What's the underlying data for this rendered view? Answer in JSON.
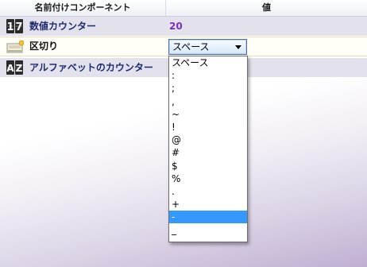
{
  "header": {
    "name_col": "名前付けコンポーネント",
    "value_col": "値"
  },
  "rows": [
    {
      "icon": "numeric-counter-icon",
      "label": "数値カウンター",
      "value": "20"
    },
    {
      "icon": "separator-icon",
      "label": "区切り"
    },
    {
      "icon": "alphabet-counter-icon",
      "label": "アルファベットのカウンター"
    }
  ],
  "separator_select": {
    "selected": "スペース",
    "options": [
      "スペース",
      ":",
      ";",
      ",",
      "~",
      "!",
      "@",
      "#",
      "$",
      "%",
      ".",
      "+",
      "-",
      "_"
    ],
    "highlighted_index": 12
  },
  "colors": {
    "header_text": "#1b1b1b",
    "label_text": "#1c2b6e",
    "value_text": "#7a2fc0",
    "highlight": "#3399ff"
  }
}
